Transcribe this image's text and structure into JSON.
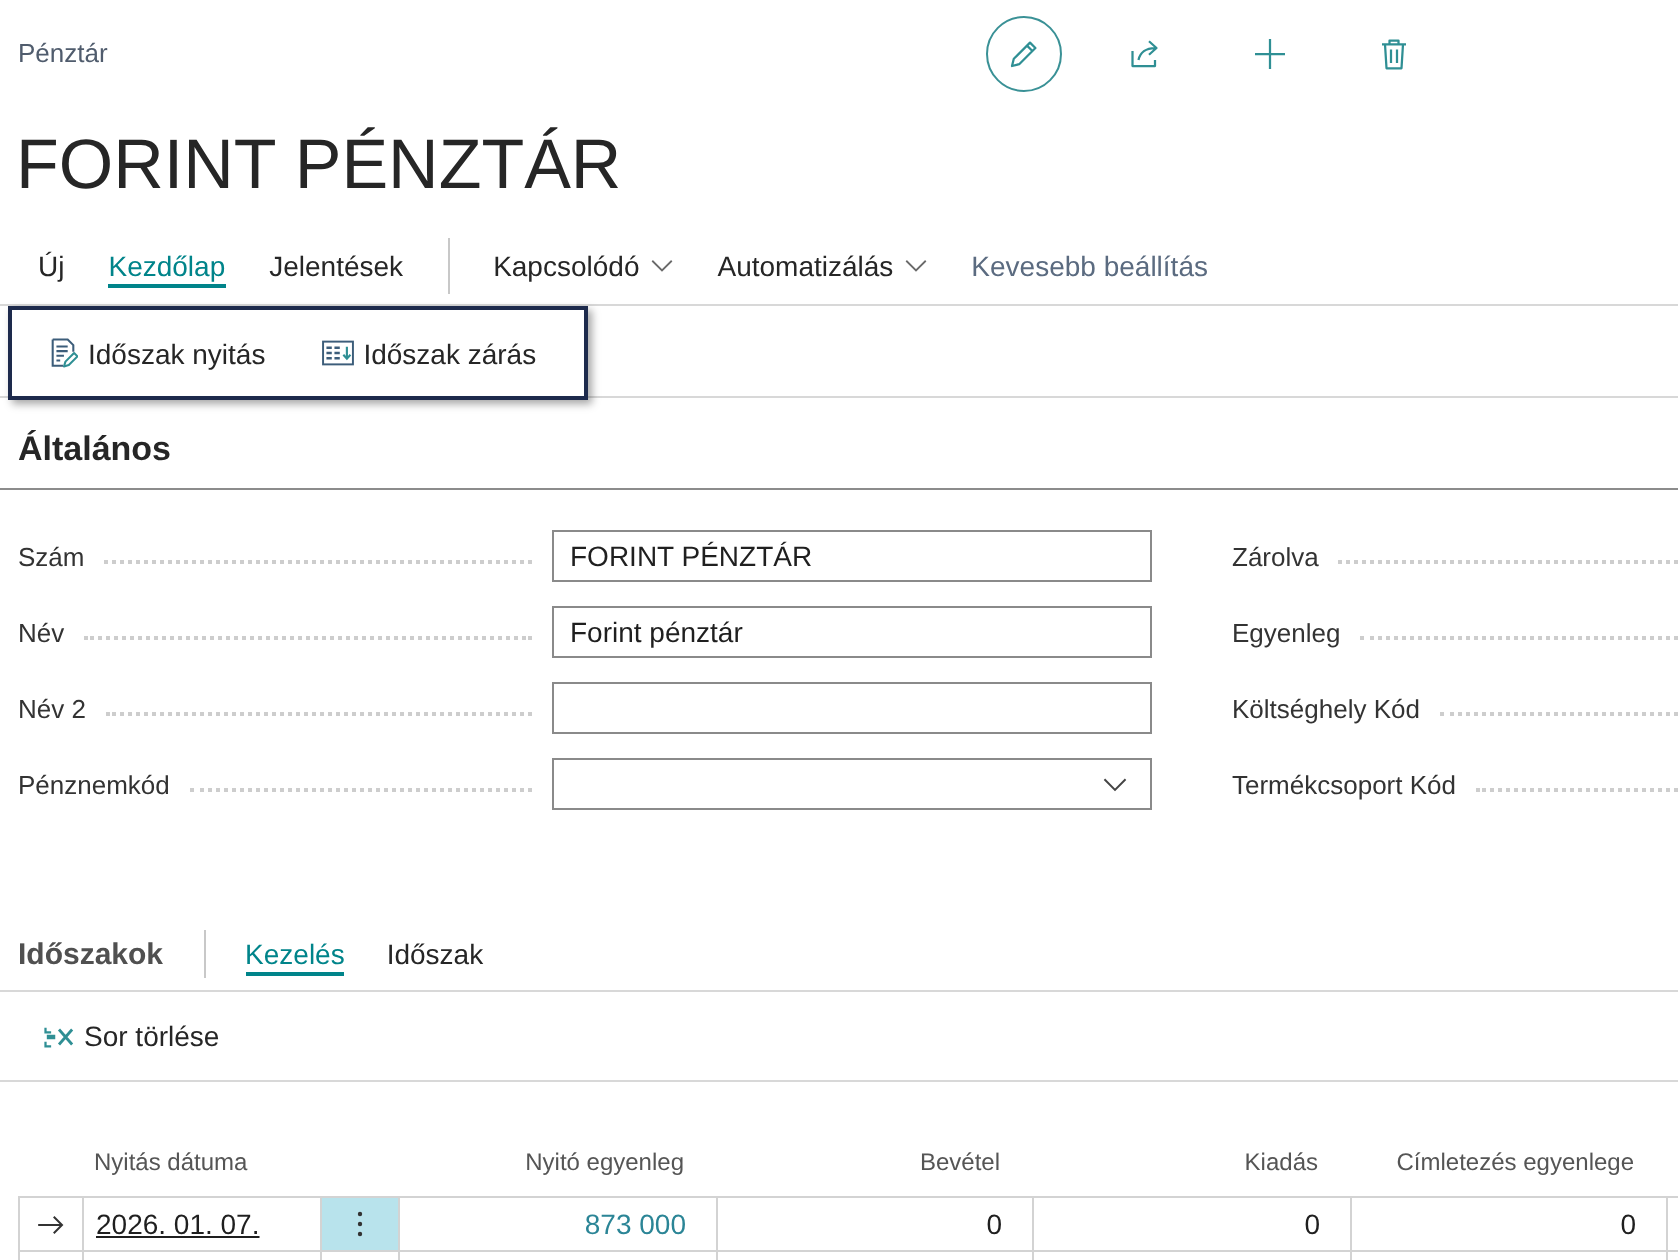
{
  "page": {
    "caption": "Pénztár",
    "title": "FORINT PÉNZTÁR"
  },
  "menu": [
    {
      "label": "Új",
      "kind": "tab",
      "selected": false
    },
    {
      "label": "Kezdőlap",
      "kind": "tab",
      "selected": true
    },
    {
      "label": "Jelentések",
      "kind": "tab",
      "selected": false
    },
    {
      "label": "Kapcsolódó",
      "kind": "dropdown",
      "selected": false
    },
    {
      "label": "Automatizálás",
      "kind": "dropdown",
      "selected": false
    },
    {
      "label": "Kevesebb beállítás",
      "kind": "toggle",
      "selected": false
    }
  ],
  "action_bar": {
    "highlighted": true,
    "items": [
      {
        "label": "Időszak nyitás",
        "kind": "open"
      },
      {
        "label": "Időszak zárás",
        "kind": "close"
      }
    ]
  },
  "general": {
    "title": "Általános",
    "fields_left": [
      {
        "label": "Szám",
        "kind": "text",
        "value": "FORINT PÉNZTÁR"
      },
      {
        "label": "Név",
        "kind": "text",
        "value": "Forint pénztár"
      },
      {
        "label": "Név 2",
        "kind": "text"
      },
      {
        "label": "Pénznemkód",
        "kind": "select"
      }
    ],
    "fields_right": [
      {
        "label": "Zárolva"
      },
      {
        "label": "Egyenleg"
      },
      {
        "label": "Költséghely Kód"
      },
      {
        "label": "Termékcsoport Kód"
      }
    ]
  },
  "periods": {
    "title": "Időszakok",
    "tabs": [
      {
        "label": "Kezelés",
        "selected": true
      },
      {
        "label": "Időszak",
        "selected": false
      }
    ],
    "actions": [
      {
        "label": "Sor törlése"
      }
    ],
    "table": {
      "columns": [
        {
          "label": "Nyitás dátuma",
          "kind": "date"
        },
        {
          "label": "Nyitó egyenleg",
          "kind": "drilldown"
        },
        {
          "label": "Bevétel",
          "kind": "number"
        },
        {
          "label": "Kiadás",
          "kind": "number"
        },
        {
          "label": "Címletezés egyenlege",
          "kind": "number"
        }
      ],
      "rows": [
        {
          "current": true,
          "cells": [
            "2026. 01. 07.",
            "873 000",
            "0",
            "0",
            "0"
          ]
        }
      ]
    }
  }
}
